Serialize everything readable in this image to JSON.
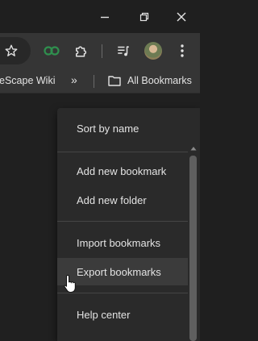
{
  "bookmarks_bar": {
    "wiki_label": "eScape Wiki",
    "overflow_label": "»",
    "all_bookmarks_label": "All Bookmarks"
  },
  "menu": {
    "items": [
      {
        "label": "Sort by name"
      },
      {
        "label": "Add new bookmark"
      },
      {
        "label": "Add new folder"
      },
      {
        "label": "Import bookmarks"
      },
      {
        "label": "Export bookmarks"
      },
      {
        "label": "Help center"
      }
    ]
  }
}
